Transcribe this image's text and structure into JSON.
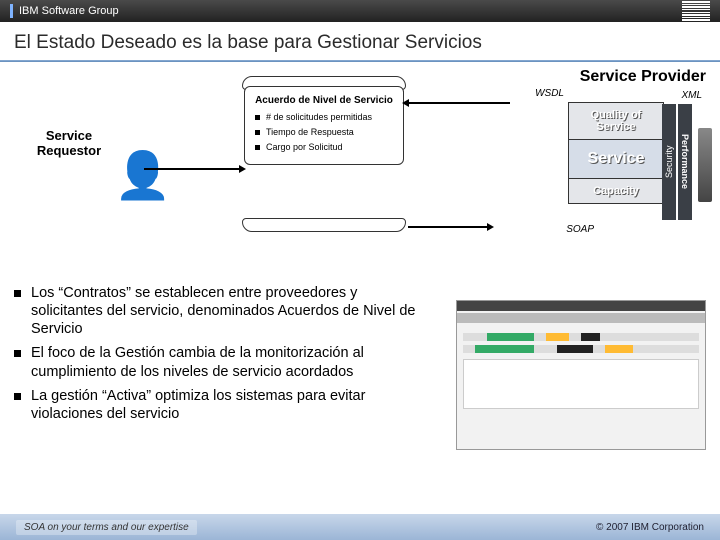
{
  "header": {
    "group": "IBM Software Group"
  },
  "title": "El Estado Deseado es la base para Gestionar Servicios",
  "diagram": {
    "provider": "Service Provider",
    "requestor": "Service\nRequestor",
    "wsdl": "WSDL",
    "xml": "XML",
    "soap": "SOAP",
    "scroll": {
      "heading": "Acuerdo de Nivel de Servicio",
      "items": [
        "# de solicitudes permitidas",
        "Tiempo de Respuesta",
        "Cargo por Solicitud"
      ]
    },
    "stack": {
      "qos": "Quality of Service",
      "service": "Service",
      "capacity": "Capacity",
      "security": "Security",
      "performance": "Performance"
    }
  },
  "bullets": [
    "Los “Contratos” se establecen entre proveedores y solicitantes del servicio, denominados Acuerdos de Nivel de Servicio",
    "El foco de la Gestión cambia de la monitorización al cumplimiento de los niveles de servicio acordados",
    "La gestión “Activa” optimiza los sistemas para evitar violaciones del servicio"
  ],
  "footer": {
    "tagline": "SOA on your terms and our expertise",
    "copyright": "© 2007 IBM Corporation"
  }
}
